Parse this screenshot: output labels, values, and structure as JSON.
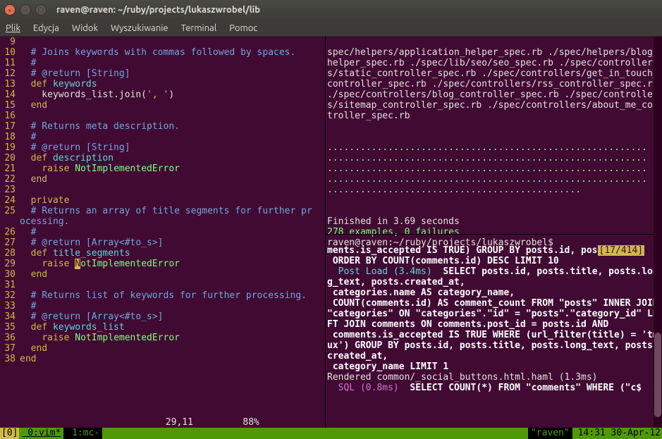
{
  "window": {
    "title": "raven@raven: ~/ruby/projects/lukaszwrobel/lib",
    "icon_close": "×",
    "icon_min": "–",
    "icon_max": "▢"
  },
  "menu": [
    "Plik",
    "Edycja",
    "Widok",
    "Wyszukiwanie",
    "Terminal",
    "Pomoc"
  ],
  "code": [
    {
      "n": "9",
      "frags": []
    },
    {
      "n": "10",
      "frags": [
        {
          "t": "  ",
          "c": "c-text"
        },
        {
          "t": "# Joins keywords with commas followed by spaces.",
          "c": "c-comment"
        }
      ]
    },
    {
      "n": "11",
      "frags": [
        {
          "t": "  ",
          "c": "c-text"
        },
        {
          "t": "#",
          "c": "c-comment"
        }
      ]
    },
    {
      "n": "12",
      "frags": [
        {
          "t": "  ",
          "c": "c-text"
        },
        {
          "t": "# @return [String]",
          "c": "c-comment"
        }
      ]
    },
    {
      "n": "13",
      "frags": [
        {
          "t": "  ",
          "c": "c-text"
        },
        {
          "t": "def",
          "c": "c-def"
        },
        {
          "t": " ",
          "c": "c-text"
        },
        {
          "t": "keywords",
          "c": "c-method"
        }
      ]
    },
    {
      "n": "14",
      "frags": [
        {
          "t": "    keywords_list.join(",
          "c": "c-text"
        },
        {
          "t": "', '",
          "c": "c-string"
        },
        {
          "t": ")",
          "c": "c-text"
        }
      ]
    },
    {
      "n": "15",
      "frags": [
        {
          "t": "  ",
          "c": "c-text"
        },
        {
          "t": "end",
          "c": "c-def"
        }
      ]
    },
    {
      "n": "16",
      "frags": []
    },
    {
      "n": "17",
      "frags": [
        {
          "t": "  ",
          "c": "c-text"
        },
        {
          "t": "# Returns meta description.",
          "c": "c-comment"
        }
      ]
    },
    {
      "n": "18",
      "frags": [
        {
          "t": "  ",
          "c": "c-text"
        },
        {
          "t": "#",
          "c": "c-comment"
        }
      ]
    },
    {
      "n": "19",
      "frags": [
        {
          "t": "  ",
          "c": "c-text"
        },
        {
          "t": "# @return [String]",
          "c": "c-comment"
        }
      ]
    },
    {
      "n": "20",
      "frags": [
        {
          "t": "  ",
          "c": "c-text"
        },
        {
          "t": "def",
          "c": "c-def"
        },
        {
          "t": " ",
          "c": "c-text"
        },
        {
          "t": "description",
          "c": "c-method"
        }
      ]
    },
    {
      "n": "21",
      "frags": [
        {
          "t": "    ",
          "c": "c-text"
        },
        {
          "t": "raise",
          "c": "c-keyword"
        },
        {
          "t": " ",
          "c": "c-text"
        },
        {
          "t": "NotImplementedError",
          "c": "c-const"
        }
      ]
    },
    {
      "n": "22",
      "frags": [
        {
          "t": "  ",
          "c": "c-text"
        },
        {
          "t": "end",
          "c": "c-def"
        }
      ]
    },
    {
      "n": "23",
      "frags": []
    },
    {
      "n": "24",
      "frags": [
        {
          "t": "  ",
          "c": "c-text"
        },
        {
          "t": "private",
          "c": "c-keyword"
        }
      ]
    },
    {
      "n": "25",
      "frags": [
        {
          "t": "  ",
          "c": "c-text"
        },
        {
          "t": "# Returns an array of title segments for further pr",
          "c": "c-comment"
        }
      ]
    },
    {
      "n": "",
      "frags": [
        {
          "t": "ocessing.",
          "c": "c-comment"
        }
      ]
    },
    {
      "n": "26",
      "frags": [
        {
          "t": "  ",
          "c": "c-text"
        },
        {
          "t": "#",
          "c": "c-comment"
        }
      ]
    },
    {
      "n": "27",
      "frags": [
        {
          "t": "  ",
          "c": "c-text"
        },
        {
          "t": "# @return [Array<#to_s>]",
          "c": "c-comment"
        }
      ]
    },
    {
      "n": "28",
      "frags": [
        {
          "t": "  ",
          "c": "c-text"
        },
        {
          "t": "def",
          "c": "c-def"
        },
        {
          "t": " ",
          "c": "c-text"
        },
        {
          "t": "title_segments",
          "c": "c-method"
        }
      ]
    },
    {
      "n": "29",
      "frags": [
        {
          "t": "    ",
          "c": "c-text"
        },
        {
          "t": "raise",
          "c": "c-keyword"
        },
        {
          "t": " ",
          "c": "c-text"
        },
        {
          "t": "N",
          "c": "cursor"
        },
        {
          "t": "otImplementedError",
          "c": "c-const"
        }
      ]
    },
    {
      "n": "30",
      "frags": [
        {
          "t": "  ",
          "c": "c-text"
        },
        {
          "t": "end",
          "c": "c-def"
        }
      ]
    },
    {
      "n": "31",
      "frags": []
    },
    {
      "n": "32",
      "frags": [
        {
          "t": "  ",
          "c": "c-text"
        },
        {
          "t": "# Returns list of keywords for further processing.",
          "c": "c-comment"
        }
      ]
    },
    {
      "n": "33",
      "frags": [
        {
          "t": "  ",
          "c": "c-text"
        },
        {
          "t": "#",
          "c": "c-comment"
        }
      ]
    },
    {
      "n": "34",
      "frags": [
        {
          "t": "  ",
          "c": "c-text"
        },
        {
          "t": "# @return [Array<#to_s>]",
          "c": "c-comment"
        }
      ]
    },
    {
      "n": "35",
      "frags": [
        {
          "t": "  ",
          "c": "c-text"
        },
        {
          "t": "def",
          "c": "c-def"
        },
        {
          "t": " ",
          "c": "c-text"
        },
        {
          "t": "keywords_list",
          "c": "c-method"
        }
      ]
    },
    {
      "n": "36",
      "frags": [
        {
          "t": "    ",
          "c": "c-text"
        },
        {
          "t": "raise",
          "c": "c-keyword"
        },
        {
          "t": " ",
          "c": "c-text"
        },
        {
          "t": "NotImplementedError",
          "c": "c-const"
        }
      ]
    },
    {
      "n": "37",
      "frags": [
        {
          "t": "  ",
          "c": "c-text"
        },
        {
          "t": "end",
          "c": "c-def"
        }
      ]
    },
    {
      "n": "38",
      "frags": [
        {
          "t": "",
          "c": "c-text"
        },
        {
          "t": "end",
          "c": "c-def"
        }
      ]
    }
  ],
  "vim_status": "                              29,11         88%",
  "right_top": {
    "spec_paths": "spec/helpers/application_helper_spec.rb ./spec/helpers/blog_helper_spec.rb ./spec/lib/seo/seo_spec.rb ./spec/controllers/static_controller_spec.rb ./spec/controllers/get_in_touch_controller_spec.rb ./spec/controllers/rss_controller_spec.rb ./spec/controllers/blog_controller_spec.rb ./spec/controllers/sitemap_controller_spec.rb ./spec/controllers/about_me_controller_spec.rb",
    "dots1": "..........................................................",
    "dots2": "..........................................................",
    "dots3": "..........................................................",
    "dots4": "..........................................................",
    "dots5": "..............................................",
    "finished": "Finished in 3.69 seconds",
    "summary": "278 examples, 0 failures",
    "prompt": "raven@raven:~/ruby/projects/lukaszwrobel$"
  },
  "right_bottom": {
    "line1a": "ments.is_accepted IS TRUE) GROUP BY posts.id, pos",
    "badge": "[17/414]",
    "line2": " ORDER BY COUNT(comments.id) DESC LIMIT 10",
    "post_load": "  Post Load (3.4ms)",
    "sel1": "  SELECT posts.id, posts.title, posts.long_text, posts.created_at,",
    "sel2": " categories.name AS category_name,",
    "sel3": " COUNT(comments.id) AS comment_count FROM \"posts\" INNER JOIN \"categories\" ON \"categories\".\"id\" = \"posts\".\"category_id\" LEFT JOIN comments ON comments.post_id = posts.id AND",
    "sel4": " comments.is_accepted IS TRUE WHERE (url_filter(title) = 'tmux') GROUP BY posts.id, posts.title, posts.long_text, posts.created_at,",
    "sel5": " category_name LIMIT 1",
    "rendered": "Rendered common/_social_buttons.html.haml (1.3ms)",
    "sql_label": "  SQL (0.8ms)",
    "sql_tail": "  SELECT COUNT(*) FROM \"comments\" WHERE (\"c$"
  },
  "tmux": {
    "session": "[0]",
    "win0": " 0:vim*",
    "win1": " 1:mc-",
    "host": "\"raven\"",
    "time": " 14:31 30-Apr-12"
  }
}
